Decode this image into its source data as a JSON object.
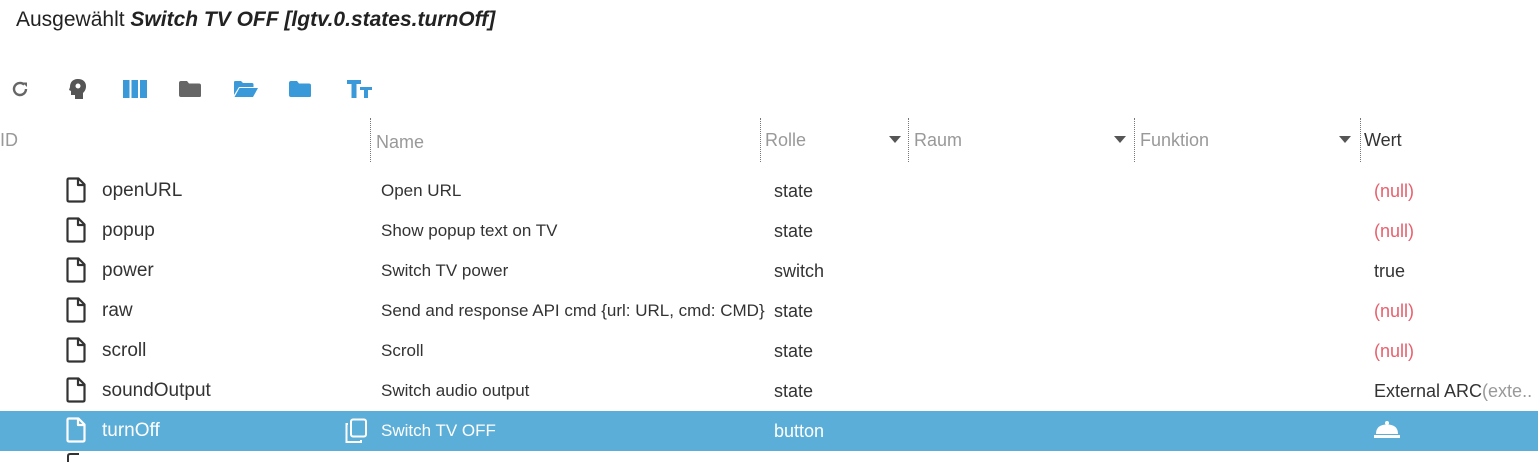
{
  "title": {
    "prefix": "Ausgewählt",
    "selected": "Switch TV OFF [lgtv.0.states.turnOff]"
  },
  "toolbar": {
    "buttons": [
      {
        "icon": "refresh-icon",
        "color": "#666666"
      },
      {
        "icon": "expert-mode-icon",
        "color": "#555555"
      },
      {
        "icon": "columns-icon",
        "color": "#3a9ad9"
      },
      {
        "icon": "folder-icon",
        "color": "#666666"
      },
      {
        "icon": "folder-open-icon",
        "color": "#3a9ad9"
      },
      {
        "icon": "folder-filled-icon",
        "color": "#3a9ad9"
      },
      {
        "icon": "text-size-icon",
        "color": "#3a9ad9"
      }
    ]
  },
  "columns": {
    "id": "ID",
    "name": "Name",
    "role": "Rolle",
    "room": "Raum",
    "function": "Funktion",
    "value": "Wert"
  },
  "rows": [
    {
      "id": "openURL",
      "name": "Open URL",
      "role": "state",
      "value": "(null)",
      "value_hint": ""
    },
    {
      "id": "popup",
      "name": "Show popup text on TV",
      "role": "state",
      "value": "(null)",
      "value_hint": ""
    },
    {
      "id": "power",
      "name": "Switch TV power",
      "role": "switch",
      "value": "true",
      "value_hint": ""
    },
    {
      "id": "raw",
      "name": "Send and response API cmd {url: URL, cmd: CMD}",
      "role": "state",
      "value": "(null)",
      "value_hint": ""
    },
    {
      "id": "scroll",
      "name": "Scroll",
      "role": "state",
      "value": "(null)",
      "value_hint": ""
    },
    {
      "id": "soundOutput",
      "name": "Switch audio output",
      "role": "state",
      "value": "External ARC",
      "value_hint": "(exte.."
    },
    {
      "id": "turnOff",
      "name": "Switch TV OFF",
      "role": "button",
      "value": "",
      "value_hint": "",
      "value_icon": "bell-button-icon",
      "selected": true
    }
  ],
  "colors": {
    "selected_row": "#5aaed8",
    "null_value": "#e8606d",
    "accent": "#3a9ad9"
  }
}
